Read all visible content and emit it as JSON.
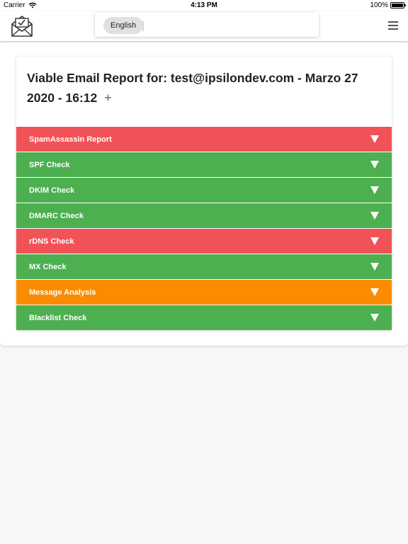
{
  "status": {
    "carrier": "Carrier",
    "time": "4:13 PM",
    "battery": "100%"
  },
  "header": {
    "language": "English"
  },
  "report": {
    "title": "Viable Email Report for: test@ipsilondev.com - Marzo 27 2020 - 16:12",
    "expand_symbol": "+",
    "checks": [
      {
        "label": "SpamAssassin Report",
        "status": "fail",
        "color": "#f15257"
      },
      {
        "label": "SPF Check",
        "status": "pass",
        "color": "#4caf50"
      },
      {
        "label": "DKIM Check",
        "status": "pass",
        "color": "#4caf50"
      },
      {
        "label": "DMARC Check",
        "status": "pass",
        "color": "#4caf50"
      },
      {
        "label": "rDNS Check",
        "status": "fail",
        "color": "#f15257"
      },
      {
        "label": "MX Check",
        "status": "pass",
        "color": "#4caf50"
      },
      {
        "label": "Message Analysis",
        "status": "warning",
        "color": "#fb8c00"
      },
      {
        "label": "Blacklist Check",
        "status": "pass",
        "color": "#4caf50"
      }
    ]
  }
}
